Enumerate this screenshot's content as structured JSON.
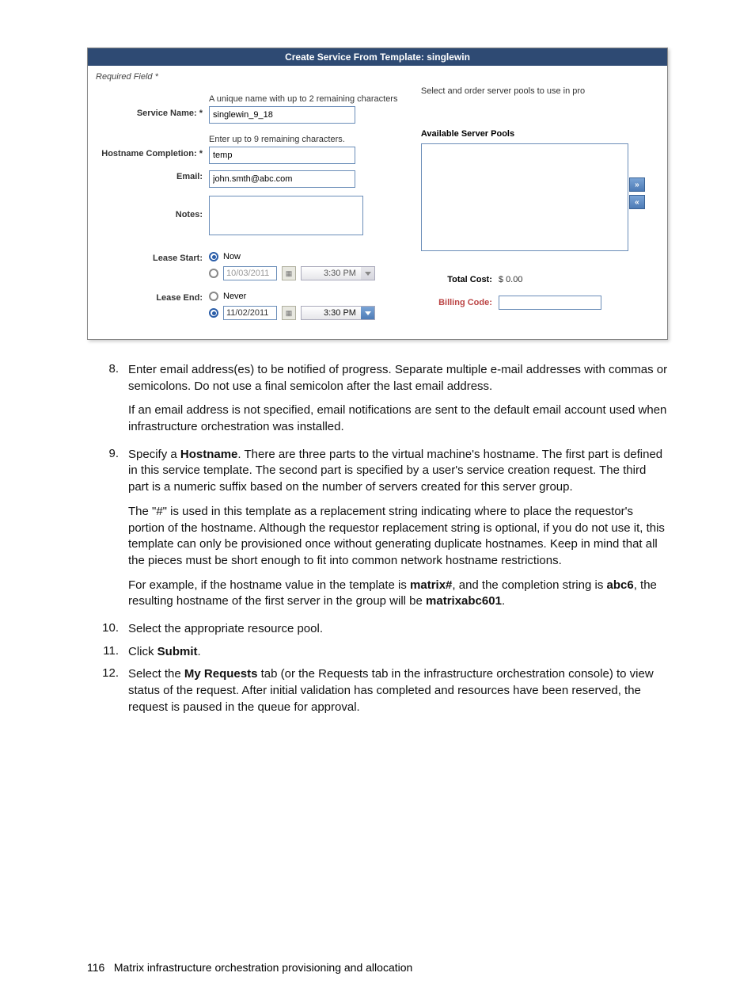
{
  "panel": {
    "title": "Create Service From Template: singlewin",
    "required_note": "Required Field *",
    "service_name": {
      "hint": "A unique name with up to 2 remaining characters",
      "label": "Service Name: *",
      "value": "singlewin_9_18"
    },
    "hostname": {
      "hint": "Enter up to 9 remaining characters.",
      "label": "Hostname Completion: *",
      "value": "temp"
    },
    "email": {
      "label": "Email:",
      "value": "john.smth@abc.com"
    },
    "notes": {
      "label": "Notes:"
    },
    "lease_start": {
      "label": "Lease Start:",
      "opt_now": "Now",
      "date": "10/03/2011",
      "time": "3:30 PM"
    },
    "lease_end": {
      "label": "Lease End:",
      "opt_never": "Never",
      "date": "11/02/2011",
      "time": "3:30 PM"
    },
    "right": {
      "hint": "Select and order server pools to use in pro",
      "pools_label": "Available Server Pools",
      "total_cost_label": "Total Cost:",
      "total_cost_value": "$ 0.00",
      "billing_label": "Billing Code:"
    },
    "shuttle": {
      "add": "»",
      "remove": "«"
    }
  },
  "doc": {
    "items": [
      {
        "num": "8.",
        "paras": [
          "Enter email address(es) to be notified of progress. Separate multiple e-mail addresses with commas or semicolons. Do not use a final semicolon after the last email address.",
          "If an email address is not specified, email notifications are sent to the default email account used when infrastructure orchestration was installed."
        ]
      }
    ],
    "item9": {
      "num": "9.",
      "p1_pre": "Specify a ",
      "p1_bold": "Hostname",
      "p1_post": ". There are three parts to the virtual machine's hostname. The first part is defined in this service template. The second part is specified by a user's service creation request. The third part is a numeric suffix based on the number of servers created for this server group.",
      "p2": "The \"#\" is used in this template as a replacement string indicating where to place the requestor's portion of the hostname. Although the requestor replacement string is optional, if you do not use it, this template can only be provisioned once without generating duplicate hostnames. Keep in mind that all the pieces must be short enough to fit into common network hostname restrictions.",
      "p3_s1": "For example, if the hostname value in the template is ",
      "p3_b1": "matrix#",
      "p3_s2": ", and the completion string is ",
      "p3_b2": "abc6",
      "p3_s3": ", the resulting hostname of the first server in the group will be ",
      "p3_b3": "matrixabc601",
      "p3_s4": "."
    },
    "item10": {
      "num": "10.",
      "text": "Select the appropriate resource pool."
    },
    "item11": {
      "num": "11.",
      "pre": "Click ",
      "bold": "Submit",
      "post": "."
    },
    "item12": {
      "num": "12.",
      "pre": "Select the ",
      "bold": "My Requests",
      "post": " tab (or the Requests tab in the infrastructure orchestration console) to view status of the request. After initial validation has completed and resources have been reserved, the request is paused in the queue for approval."
    }
  },
  "footer": {
    "page": "116",
    "title": "Matrix infrastructure orchestration provisioning and allocation"
  }
}
